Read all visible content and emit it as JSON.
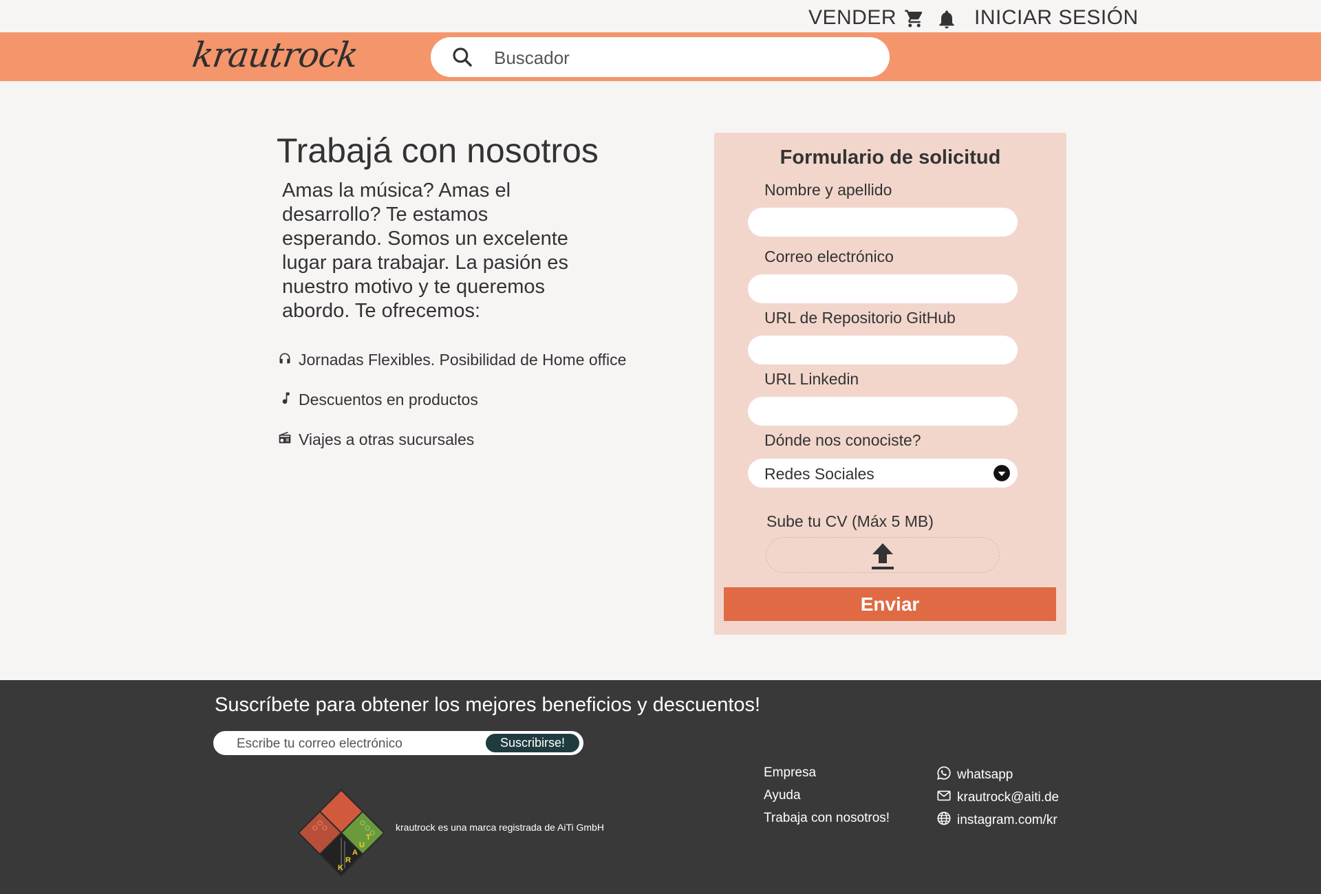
{
  "topbar": {
    "sell_label": "VENDER",
    "cart_icon": "cart-icon",
    "bell_icon": "bell-icon",
    "login_label": "INICIAR SESIÓN"
  },
  "header": {
    "logo_text": "krautrock",
    "search_placeholder": "Buscador",
    "bg_color": "#f4956c"
  },
  "main": {
    "title": "Trabajá con nosotros",
    "intro": "Amas la música? Amas el desarrollo? Te estamos esperando. Somos un excelente lugar para trabajar. La pasión es nuestro motivo y te queremos abordo. Te ofrecemos:",
    "benefits": [
      {
        "icon": "headphones-icon",
        "text": "Jornadas Flexibles. Posibilidad de Home office"
      },
      {
        "icon": "music-note-icon",
        "text": "Descuentos en productos"
      },
      {
        "icon": "radio-icon",
        "text": "Viajes a otras sucursales"
      }
    ]
  },
  "form": {
    "title": "Formulario de solicitud",
    "fields": [
      {
        "label": "Nombre y apellido",
        "value": ""
      },
      {
        "label": "Correo electrónico",
        "value": ""
      },
      {
        "label": "URL de Repositorio GitHub",
        "value": ""
      },
      {
        "label": "URL Linkedin",
        "value": ""
      }
    ],
    "source_label": "Dónde nos conociste?",
    "source_selected": "Redes Sociales",
    "upload_label": "Sube tu CV (Máx 5 MB)",
    "submit_label": "Enviar",
    "panel_color": "#f2d6cc",
    "submit_color": "#e06a43"
  },
  "footer": {
    "heading": "Suscríbete para obtener los mejores beneficios y descuentos!",
    "email_placeholder": "Escribe tu correo electrónico",
    "subscribe_label": "Suscribirse!",
    "trademark": "krautrock es una marca registrada de AiTi GmbH",
    "logo_letters": [
      "K",
      "R",
      "A",
      "U",
      "T"
    ],
    "links": [
      "Empresa",
      "Ayuda",
      "Trabaja con nosotros!"
    ],
    "contacts": [
      {
        "icon": "whatsapp-icon",
        "text": "whatsapp"
      },
      {
        "icon": "mail-icon",
        "text": "krautrock@aiti.de"
      },
      {
        "icon": "globe-icon",
        "text": "instagram.com/kr"
      }
    ],
    "bg_color": "#3a3939"
  }
}
